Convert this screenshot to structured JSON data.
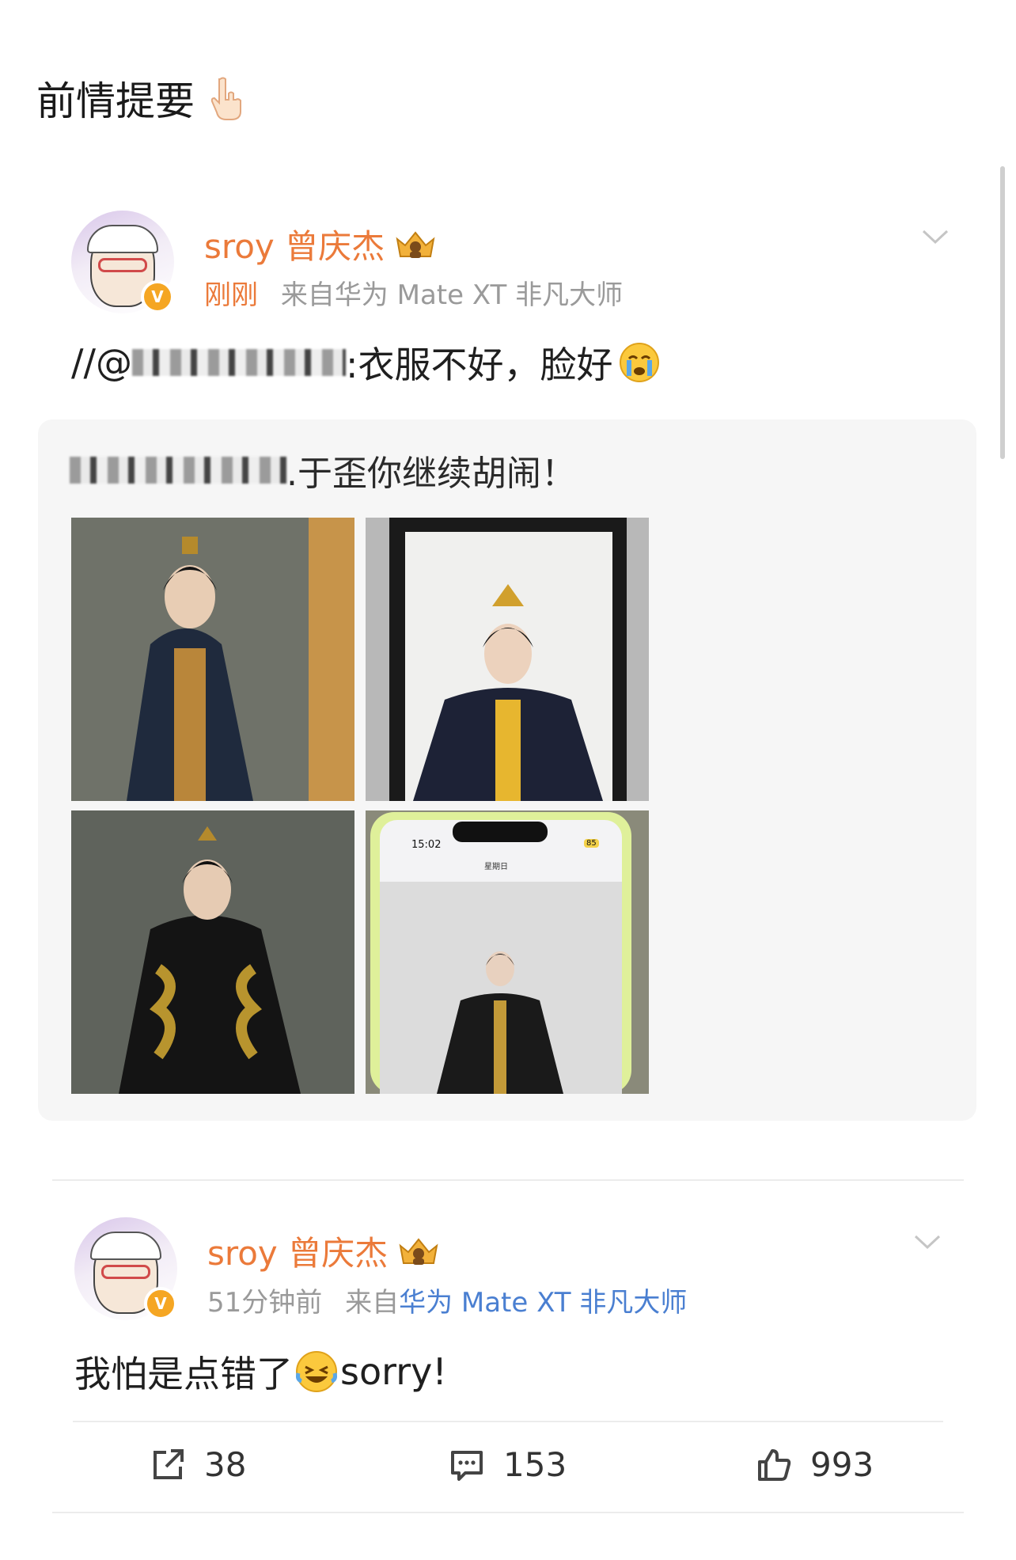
{
  "caption": {
    "text": "前情提要",
    "emoji_icon": "hand-pointing-down-icon"
  },
  "post1": {
    "username": "sroy 曾庆杰",
    "badge_icon": "crown-badge-icon",
    "time": "刚刚",
    "source_prefix": "来自",
    "device": "华为 Mate XT 非凡大师",
    "text_prefix": "//@",
    "text": ":衣服不好，脸好",
    "text_emoji": "crying-face-emoji-icon",
    "repost": {
      "text": ".于歪你继续胡闹！",
      "photos": [
        "photo-1",
        "photo-2",
        "photo-3",
        "photo-4"
      ]
    }
  },
  "post2": {
    "username": "sroy 曾庆杰",
    "badge_icon": "crown-badge-icon",
    "time": "51分钟前",
    "source_prefix": "来自",
    "device": "华为 Mate XT 非凡大师",
    "text": "我怕是点错了",
    "text_emoji": "laughing-tears-emoji-icon",
    "text_suffix": "sorry!"
  },
  "actions": {
    "share_count": "38",
    "comment_count": "153",
    "like_count": "993"
  },
  "phone_photo": {
    "time": "15:02",
    "battery": "85",
    "day": "星期日"
  },
  "colors": {
    "username": "#eb7a3a",
    "meta": "#9a9a9a",
    "device_link": "#4a7fd1",
    "verify": "#f5a623"
  }
}
